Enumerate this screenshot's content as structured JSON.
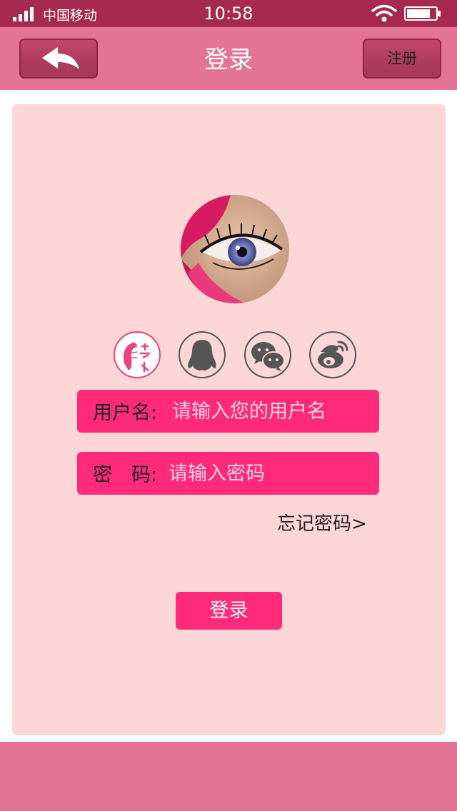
{
  "status_bar": {
    "carrier": "中国移动",
    "time": "10:58"
  },
  "header": {
    "title": "登录",
    "register_label": "注册"
  },
  "social_logins": [
    "brand-logo-icon",
    "qq-icon",
    "wechat-icon",
    "weibo-icon"
  ],
  "form": {
    "username_label": "用户名:",
    "username_placeholder": "请输入您的用户名",
    "password_label": "密　码:",
    "password_placeholder": "请输入密码",
    "forgot_label": "忘记密码>",
    "login_label": "登录"
  },
  "colors": {
    "status_bar": "#a6294f",
    "header": "#e47494",
    "card": "#fdd6d8",
    "accent": "#ff2a7a"
  }
}
